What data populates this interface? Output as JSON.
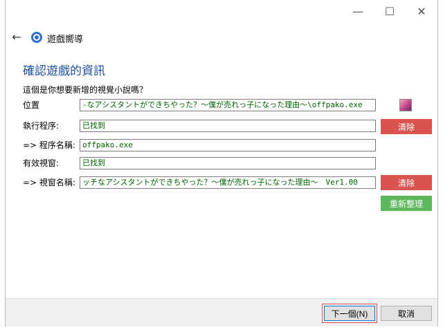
{
  "window": {
    "title_icon": "search-icon",
    "app_title": "遊戲嚮導",
    "controls": {
      "minimize": "—",
      "maximize": "☐",
      "close": "✕"
    },
    "back_glyph": "←"
  },
  "main": {
    "heading": "確認遊戲的資訊",
    "question": "這個是你想要新增的視覺小說嗎？",
    "rows": {
      "location": {
        "label": "位置",
        "value": "-なアシスタントができちやった？～僕が売れっ子になった理由～\\offpako.exe"
      },
      "executable": {
        "label": "執行程序:",
        "value": "已找到",
        "clear_label": "清除"
      },
      "program_name": {
        "label": "=> 程序名稱:",
        "value": "offpako.exe"
      },
      "valid_window": {
        "label": "有效視窗:",
        "value": "已找到"
      },
      "window_name": {
        "label": "=> 視窗名稱:",
        "value": "ッチなアシスタントができちやった？～僕が売れっ子になった理由～　Ver1.00",
        "clear_label": "清除",
        "refresh_label": "重新整理"
      }
    }
  },
  "footer": {
    "next_label": "下一個(N)",
    "cancel_label": "取消"
  },
  "colors": {
    "accent": "#1f4e9c",
    "danger": "#d9534f",
    "success": "#5cb85c",
    "field_text": "#006400"
  }
}
